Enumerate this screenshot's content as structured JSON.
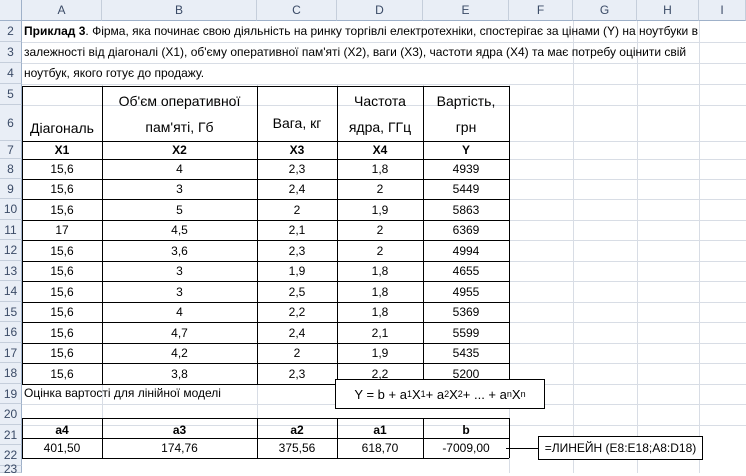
{
  "columns": [
    "A",
    "B",
    "C",
    "D",
    "E",
    "F",
    "G",
    "H",
    "I"
  ],
  "rows": [
    "2",
    "3",
    "4",
    "5",
    "6",
    "7",
    "8",
    "9",
    "10",
    "11",
    "12",
    "13",
    "14",
    "15",
    "16",
    "17",
    "18",
    "19",
    "20",
    "21",
    "22",
    "23"
  ],
  "problem": {
    "label": "Приклад 3",
    "line1": ". Фірма, яка починає свою діяльність на ринку торгівлі електротехніки, спостерігає за цінами (Y) на ноутбуки в",
    "line2": "залежності від діагоналі (X1), об'єму оперативної пам'яті (X2), ваги (X3), частоти ядра (X4) та має потребу оцінити свій",
    "line3": "ноутбук, якого готує до продажу."
  },
  "table": {
    "headers": [
      {
        "line1": "Діагональ",
        "line2": ""
      },
      {
        "line1": "Об'єм оперативної",
        "line2": "пам'яті, Гб"
      },
      {
        "line1": "Вага, кг",
        "line2": ""
      },
      {
        "line1": "Частота",
        "line2": "ядра, ГГц"
      },
      {
        "line1": "Вартість,",
        "line2": "грн"
      }
    ],
    "vars": [
      "X1",
      "X2",
      "X3",
      "X4",
      "Y"
    ],
    "data": [
      [
        "15,6",
        "4",
        "2,3",
        "1,8",
        "4939"
      ],
      [
        "15,6",
        "3",
        "2,4",
        "2",
        "5449"
      ],
      [
        "15,6",
        "5",
        "2",
        "1,9",
        "5863"
      ],
      [
        "17",
        "4,5",
        "2,1",
        "2",
        "6369"
      ],
      [
        "15,6",
        "3,6",
        "2,3",
        "2",
        "4994"
      ],
      [
        "15,6",
        "3",
        "1,9",
        "1,8",
        "4655"
      ],
      [
        "15,6",
        "3",
        "2,5",
        "1,8",
        "4955"
      ],
      [
        "15,6",
        "4",
        "2,2",
        "1,8",
        "5369"
      ],
      [
        "15,6",
        "4,7",
        "2,4",
        "2,1",
        "5599"
      ],
      [
        "15,6",
        "4,2",
        "2",
        "1,9",
        "5435"
      ],
      [
        "15,6",
        "3,8",
        "2,3",
        "2,2",
        "5200"
      ]
    ]
  },
  "estimate_label": "Оцінка вартості для лінійної моделі",
  "formula": {
    "y": "Y = b + a",
    "s1": "1",
    "x1": "X",
    "t1": "1",
    "mid": " + a",
    "s2": "2",
    "x2": "X",
    "t2": "2",
    "rest": " + ... + a",
    "sn": "n",
    "xn": "X",
    "tn": "n"
  },
  "coef": {
    "headers": [
      "a4",
      "a3",
      "a2",
      "a1",
      "b"
    ],
    "values": [
      "401,50",
      "174,76",
      "375,56",
      "618,70",
      "-7009,00"
    ]
  },
  "linest_formula": "=ЛИНЕЙН (E8:E18;A8:D18)"
}
